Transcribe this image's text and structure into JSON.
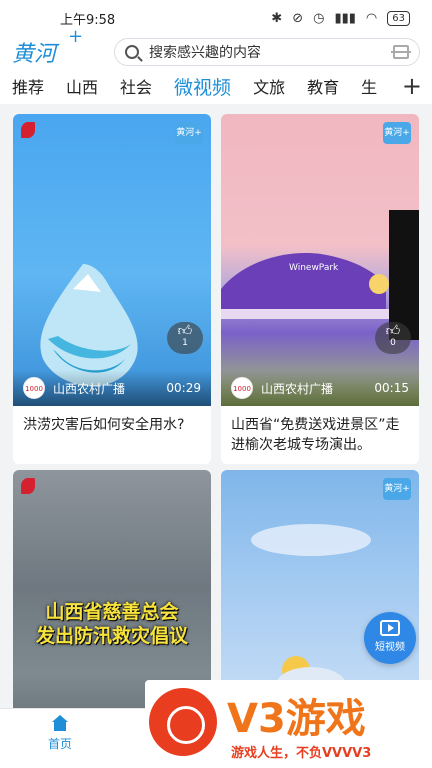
{
  "status": {
    "time": "上午9:58",
    "battery": "63"
  },
  "header": {
    "logo": "黄河",
    "logo_plus": "+",
    "search_placeholder": "搜索感兴趣的内容"
  },
  "tabs": [
    "推荐",
    "山西",
    "社会",
    "微视频",
    "文旅",
    "教育",
    "生"
  ],
  "tabs_add": "+",
  "active_tab": "微视频",
  "cards": [
    {
      "source": "山西农村广播",
      "duration": "00:29",
      "likes": "1",
      "title": "洪涝灾害后如何安全用水?",
      "badge": "黄河+"
    },
    {
      "source": "山西农村广播",
      "duration": "00:15",
      "likes": "0",
      "title": "山西省“免费送戏进景区”走进榆次老城专场演出。",
      "badge": "黄河+",
      "sign": "WinewPark"
    },
    {
      "overlay_line1": "山西省慈善总会",
      "overlay_line2": "发出防汛救灾倡议"
    },
    {
      "badge": "黄河+"
    }
  ],
  "short_video_button": "短视频",
  "bottom_nav": {
    "home": "首页"
  },
  "watermark": {
    "brand": "V3游戏",
    "slogan": "游戏人生，不负VVVV3"
  },
  "colors": {
    "accent": "#1e8ed8",
    "watermark_orange": "#f0751a",
    "watermark_red": "#e83d1f"
  }
}
